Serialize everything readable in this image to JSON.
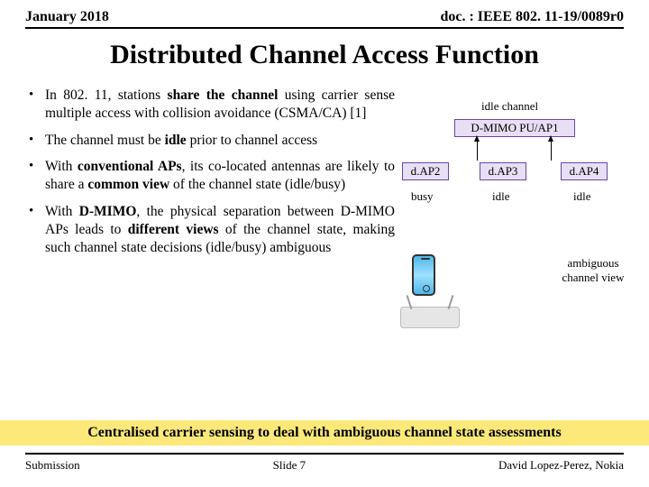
{
  "header": {
    "left": "January 2018",
    "right": "doc. : IEEE 802. 11-19/0089r0"
  },
  "title": "Distributed Channel Access Function",
  "bullets": [
    {
      "pre": "In 802. 11, stations ",
      "b1": "share the channel",
      "post": " using carrier sense multiple access with collision avoidance (CSMA/CA) [1]"
    },
    {
      "pre": "The channel must be ",
      "b1": "idle",
      "post": " prior to channel access"
    },
    {
      "pre": "With ",
      "b1": "conventional APs",
      "mid": ", its co-located antennas are likely to share a ",
      "b2": "common view",
      "post": " of the channel state (idle/busy)"
    },
    {
      "pre": "With ",
      "b1": "D-MIMO",
      "mid": ", the physical separation between D-MIMO APs leads to ",
      "b2": "different views",
      "post": " of the channel state, making such channel state decisions (idle/busy) ambiguous"
    }
  ],
  "diagram": {
    "idle_channel": "idle channel",
    "dmimo": "D-MIMO PU/AP1",
    "ap2": "d.AP2",
    "ap3": "d.AP3",
    "ap4": "d.AP4",
    "s2": "busy",
    "s3": "idle",
    "s4": "idle",
    "ambiguous": "ambiguous channel view"
  },
  "banner": "Centralised carrier sensing to deal with ambiguous channel state assessments",
  "footer": {
    "left": "Submission",
    "mid": "Slide 7",
    "right": "David Lopez-Perez, Nokia"
  }
}
